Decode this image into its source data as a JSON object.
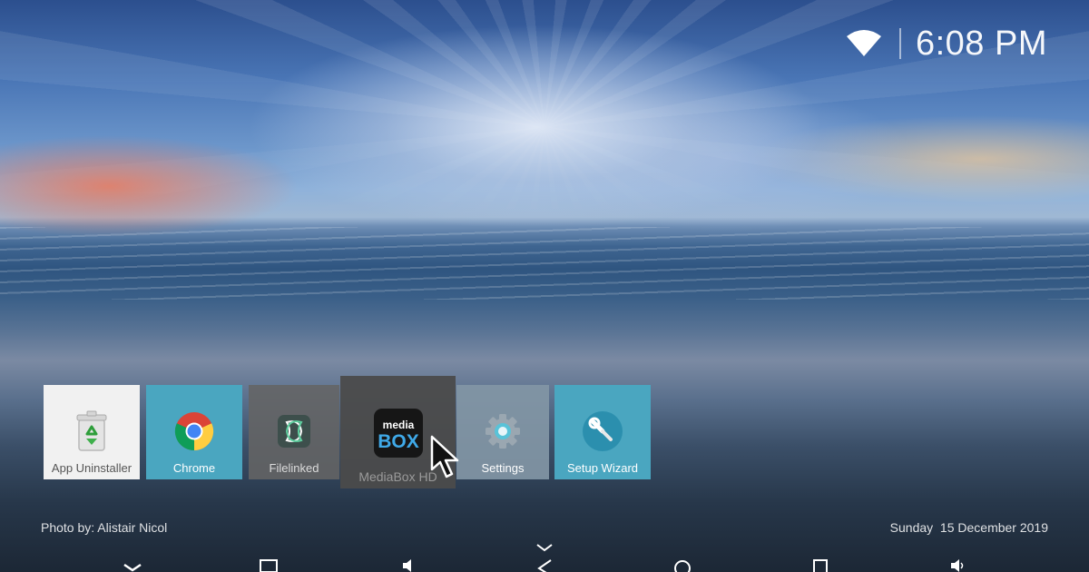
{
  "status_bar": {
    "wifi_icon": "wifi-icon",
    "time": "6:08 PM"
  },
  "apps": [
    {
      "label": "App Uninstaller",
      "icon": "recycle-bin-icon"
    },
    {
      "label": "Chrome",
      "icon": "chrome-icon"
    },
    {
      "label": "Filelinked",
      "icon": "filelinked-icon"
    },
    {
      "label": "MediaBox HD",
      "icon": "mediabox-icon",
      "icon_text_top": "media",
      "icon_text_bottom": "BOX"
    },
    {
      "label": "Settings",
      "icon": "gear-icon"
    },
    {
      "label": "Setup Wizard",
      "icon": "wrench-icon"
    }
  ],
  "footer": {
    "photo_credit": "Photo by: Alistair Nicol",
    "date": "Sunday  15 December 2019"
  },
  "navbar": {
    "icons": [
      "chevron-up-icon",
      "collapse-icon",
      "screenshot-icon",
      "volume-down-icon",
      "back-icon",
      "home-icon",
      "recents-icon",
      "volume-up-icon"
    ]
  },
  "colors": {
    "tile_teal": "#4aa6c0",
    "tile_white": "#f1f1f1",
    "tile_focus": "#4b4b4b"
  }
}
